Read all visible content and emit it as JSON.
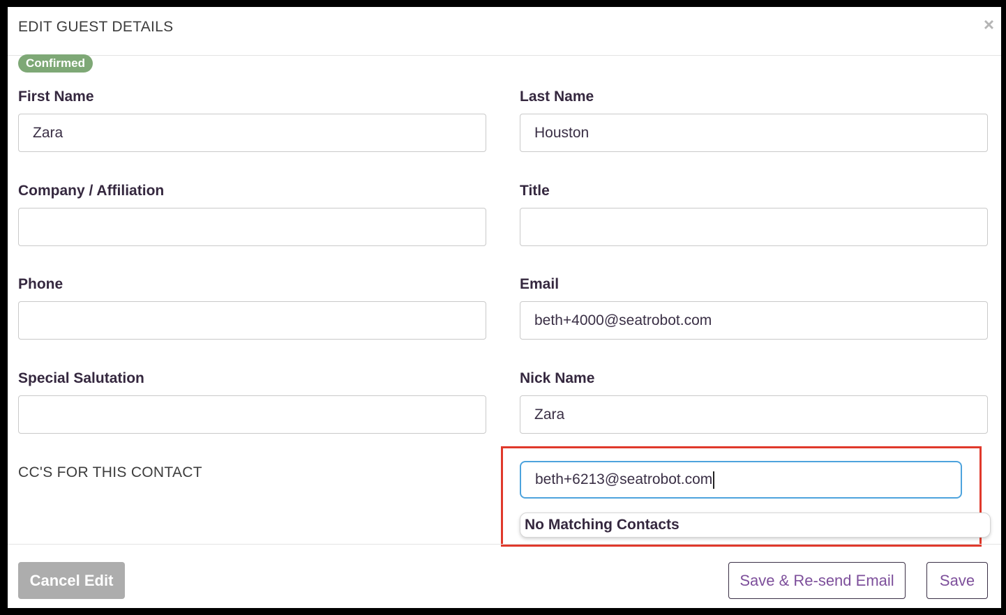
{
  "modal": {
    "title": "EDIT GUEST DETAILS",
    "close_glyph": "×",
    "status_badge": "Confirmed"
  },
  "fields": {
    "first_name": {
      "label": "First Name",
      "value": "Zara"
    },
    "last_name": {
      "label": "Last Name",
      "value": "Houston"
    },
    "company": {
      "label": "Company / Affiliation",
      "value": ""
    },
    "title": {
      "label": "Title",
      "value": ""
    },
    "phone": {
      "label": "Phone",
      "value": ""
    },
    "email": {
      "label": "Email",
      "value": "beth+4000@seatrobot.com"
    },
    "special_salutation": {
      "label": "Special Salutation",
      "value": ""
    },
    "nick_name": {
      "label": "Nick Name",
      "value": "Zara"
    }
  },
  "cc": {
    "label": "CC'S FOR THIS CONTACT",
    "input_value": "beth+6213@seatrobot.com",
    "dropdown_message": "No Matching Contacts"
  },
  "footer": {
    "cancel_label": "Cancel Edit",
    "resend_label": "Save & Re-send Email",
    "save_label": "Save"
  },
  "colors": {
    "badge": "#7ea876",
    "highlight": "#e0392b",
    "focus_border": "#4da3dd",
    "button_text": "#7d4f9b",
    "cancel_bg": "#adadad"
  },
  "icons": {
    "close": "close-icon"
  }
}
